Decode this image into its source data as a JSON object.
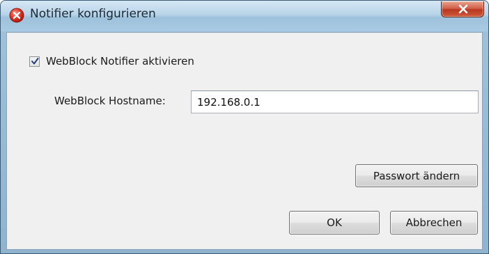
{
  "window": {
    "title": "Notifier konfigurieren",
    "icon": "error-circle-icon",
    "close_icon": "close-icon"
  },
  "form": {
    "activate_checkbox": {
      "label": "WebBlock Notifier aktivieren",
      "checked": true
    },
    "hostname": {
      "label": "WebBlock Hostname:",
      "value": "192.168.0.1"
    }
  },
  "buttons": {
    "change_password": "Passwort ändern",
    "ok": "OK",
    "cancel": "Abbrechen"
  },
  "colors": {
    "title_icon": "#d9342b",
    "close_button": "#c84a30",
    "dialog_background": "#f0f0f0"
  }
}
